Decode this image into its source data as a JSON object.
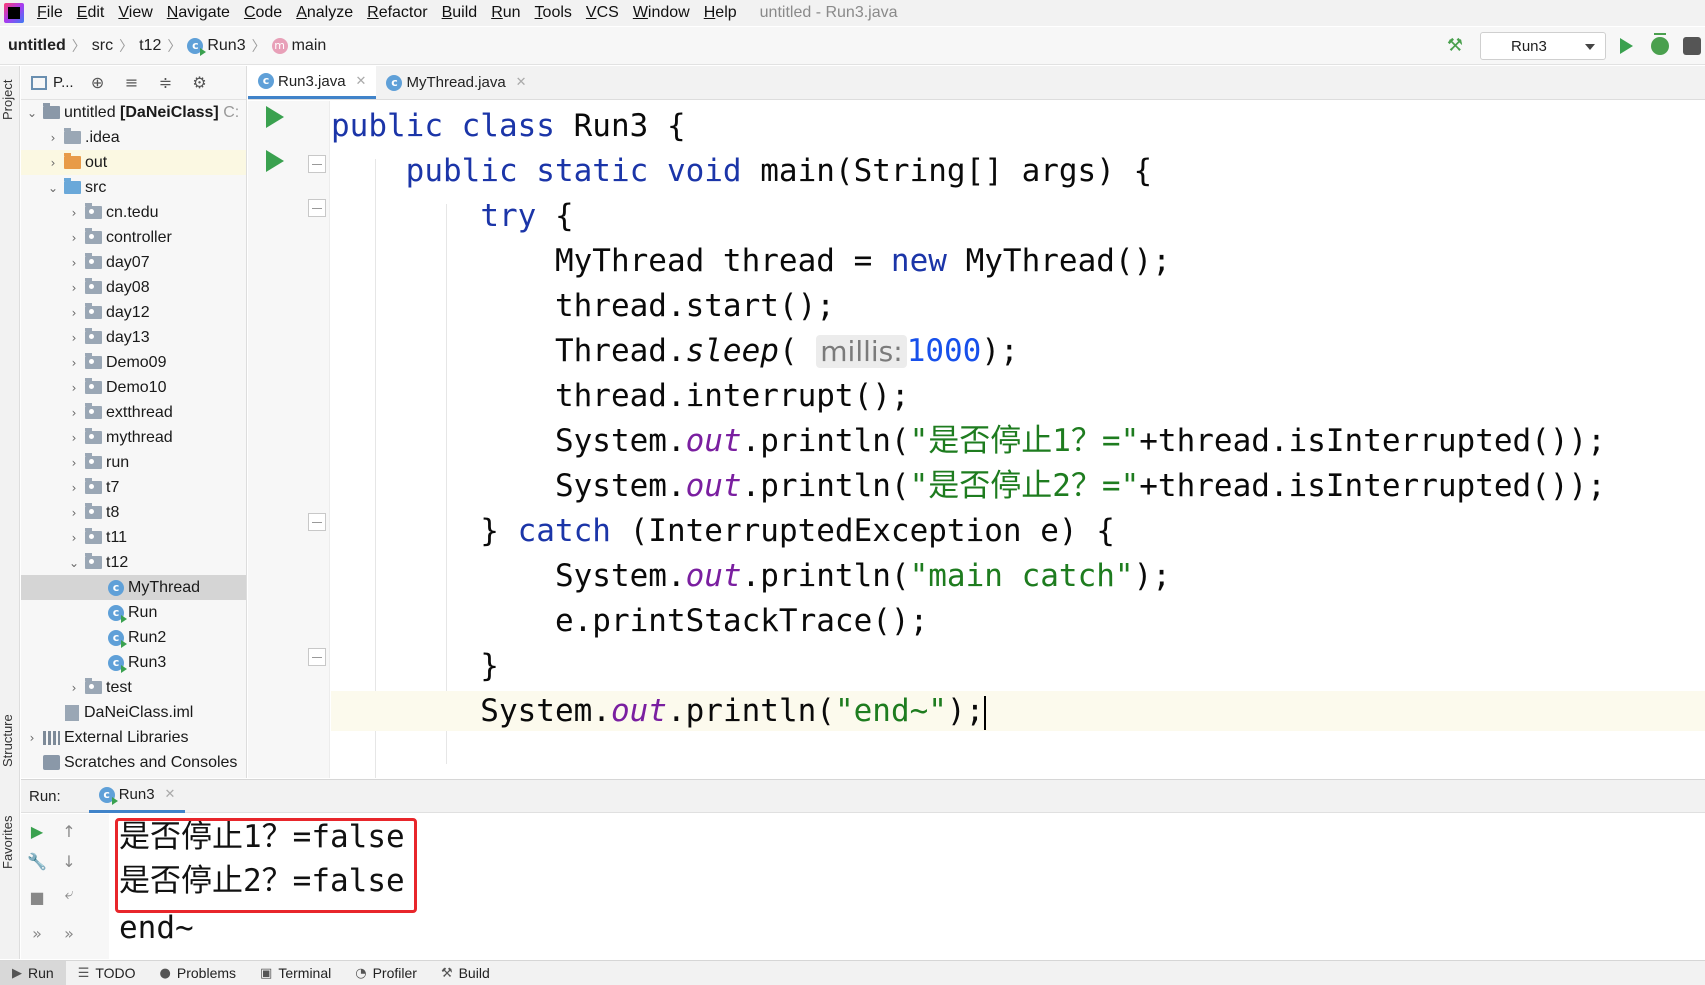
{
  "menubar": {
    "items": [
      "File",
      "Edit",
      "View",
      "Navigate",
      "Code",
      "Analyze",
      "Refactor",
      "Build",
      "Run",
      "Tools",
      "VCS",
      "Window",
      "Help"
    ],
    "window_title": "untitled - Run3.java"
  },
  "navbar": {
    "breadcrumbs": [
      "untitled",
      "src",
      "t12",
      "Run3",
      "main"
    ],
    "run_config": "Run3"
  },
  "left_stripe": {
    "project": "Project",
    "structure": "Structure",
    "favorites": "Favorites"
  },
  "project_panel": {
    "toolbar_label": "P...",
    "tree": [
      {
        "label": "untitled",
        "suffix": "[DaNeiClass]",
        "hint": "C:",
        "depth": 0,
        "arrow": "open",
        "icon": "root-folder"
      },
      {
        "label": ".idea",
        "depth": 1,
        "arrow": "closed",
        "icon": "folder"
      },
      {
        "label": "out",
        "depth": 1,
        "arrow": "closed",
        "icon": "folder-orange"
      },
      {
        "label": "src",
        "depth": 1,
        "arrow": "open",
        "icon": "folder-blue"
      },
      {
        "label": "cn.tedu",
        "depth": 2,
        "arrow": "closed",
        "icon": "package"
      },
      {
        "label": "controller",
        "depth": 2,
        "arrow": "closed",
        "icon": "package"
      },
      {
        "label": "day07",
        "depth": 2,
        "arrow": "closed",
        "icon": "package"
      },
      {
        "label": "day08",
        "depth": 2,
        "arrow": "closed",
        "icon": "package"
      },
      {
        "label": "day12",
        "depth": 2,
        "arrow": "closed",
        "icon": "package"
      },
      {
        "label": "day13",
        "depth": 2,
        "arrow": "closed",
        "icon": "package"
      },
      {
        "label": "Demo09",
        "depth": 2,
        "arrow": "closed",
        "icon": "package"
      },
      {
        "label": "Demo10",
        "depth": 2,
        "arrow": "closed",
        "icon": "package"
      },
      {
        "label": "extthread",
        "depth": 2,
        "arrow": "closed",
        "icon": "package"
      },
      {
        "label": "mythread",
        "depth": 2,
        "arrow": "closed",
        "icon": "package"
      },
      {
        "label": "run",
        "depth": 2,
        "arrow": "closed",
        "icon": "package"
      },
      {
        "label": "t7",
        "depth": 2,
        "arrow": "closed",
        "icon": "package"
      },
      {
        "label": "t8",
        "depth": 2,
        "arrow": "closed",
        "icon": "package"
      },
      {
        "label": "t11",
        "depth": 2,
        "arrow": "closed",
        "icon": "package"
      },
      {
        "label": "t12",
        "depth": 2,
        "arrow": "open",
        "icon": "package"
      },
      {
        "label": "MyThread",
        "depth": 3,
        "arrow": "none",
        "icon": "class"
      },
      {
        "label": "Run",
        "depth": 3,
        "arrow": "none",
        "icon": "class-run"
      },
      {
        "label": "Run2",
        "depth": 3,
        "arrow": "none",
        "icon": "class-run"
      },
      {
        "label": "Run3",
        "depth": 3,
        "arrow": "none",
        "icon": "class-run"
      },
      {
        "label": "test",
        "depth": 2,
        "arrow": "closed",
        "icon": "package"
      },
      {
        "label": "DaNeiClass.iml",
        "depth": 1,
        "arrow": "none",
        "icon": "file"
      },
      {
        "label": "External Libraries",
        "depth": 0,
        "arrow": "closed",
        "icon": "library"
      },
      {
        "label": "Scratches and Consoles",
        "depth": 0,
        "arrow": "none",
        "icon": "scratches"
      }
    ]
  },
  "editor": {
    "tabs": [
      {
        "label": "Run3.java",
        "active": true
      },
      {
        "label": "MyThread.java",
        "active": false
      }
    ]
  },
  "run_window": {
    "label": "Run:",
    "tab": "Run3",
    "output": [
      "是否停止1？=false",
      "是否停止2？=false",
      "end~"
    ]
  },
  "bottom_bar": {
    "items": [
      "Run",
      "TODO",
      "Problems",
      "Terminal",
      "Profiler",
      "Build"
    ]
  }
}
